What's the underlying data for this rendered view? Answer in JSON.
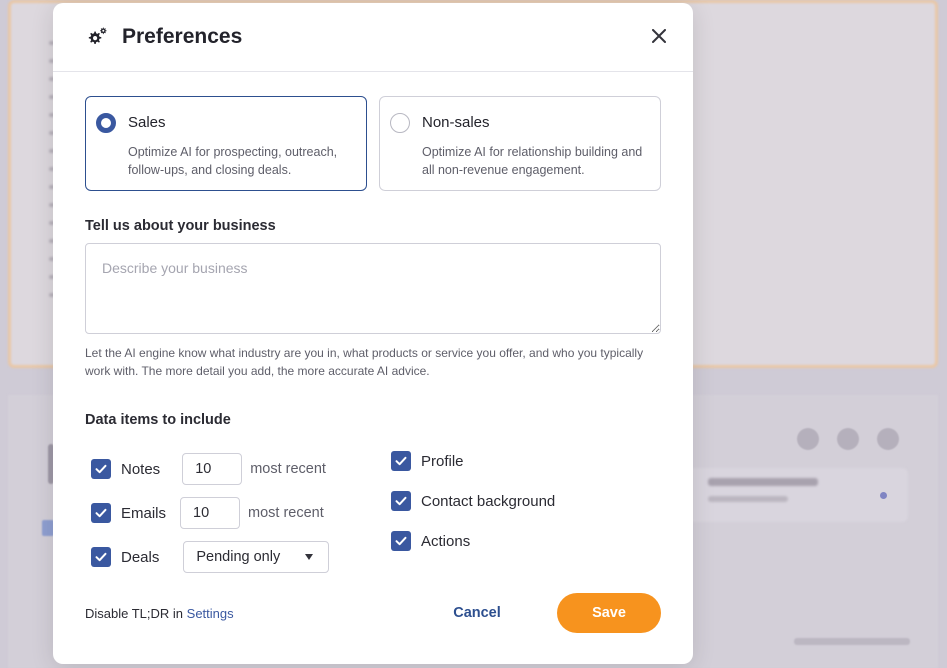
{
  "modal": {
    "title": "Preferences",
    "icon": "gear-icon",
    "close_icon": "close-icon"
  },
  "mode": {
    "options": [
      {
        "title": "Sales",
        "description": "Optimize AI for prospecting, outreach, follow-ups, and closing deals.",
        "selected": true
      },
      {
        "title": "Non-sales",
        "description": "Optimize AI for relationship building and all non-revenue engagement.",
        "selected": false
      }
    ]
  },
  "business": {
    "label": "Tell us about your business",
    "value": "",
    "placeholder": "Describe your business",
    "helper": "Let the AI engine know what industry are you in, what products or service you offer, and who you typically work with. The more detail you add, the more accurate AI advice."
  },
  "data_items": {
    "label": "Data items to include",
    "notes": {
      "label": "Notes",
      "checked": true,
      "count": "10",
      "suffix": "most recent"
    },
    "emails": {
      "label": "Emails",
      "checked": true,
      "count": "10",
      "suffix": "most recent"
    },
    "deals": {
      "label": "Deals",
      "checked": true,
      "selected": "Pending only"
    },
    "profile": {
      "label": "Profile",
      "checked": true
    },
    "contact_background": {
      "label": "Contact background",
      "checked": true
    },
    "actions": {
      "label": "Actions",
      "checked": true
    }
  },
  "footer": {
    "disable_text": "Disable TL;DR in",
    "settings_link": "Settings",
    "cancel_label": "Cancel",
    "save_label": "Save"
  },
  "colors": {
    "accent": "#3a58a0",
    "save_button": "#f7931e"
  }
}
